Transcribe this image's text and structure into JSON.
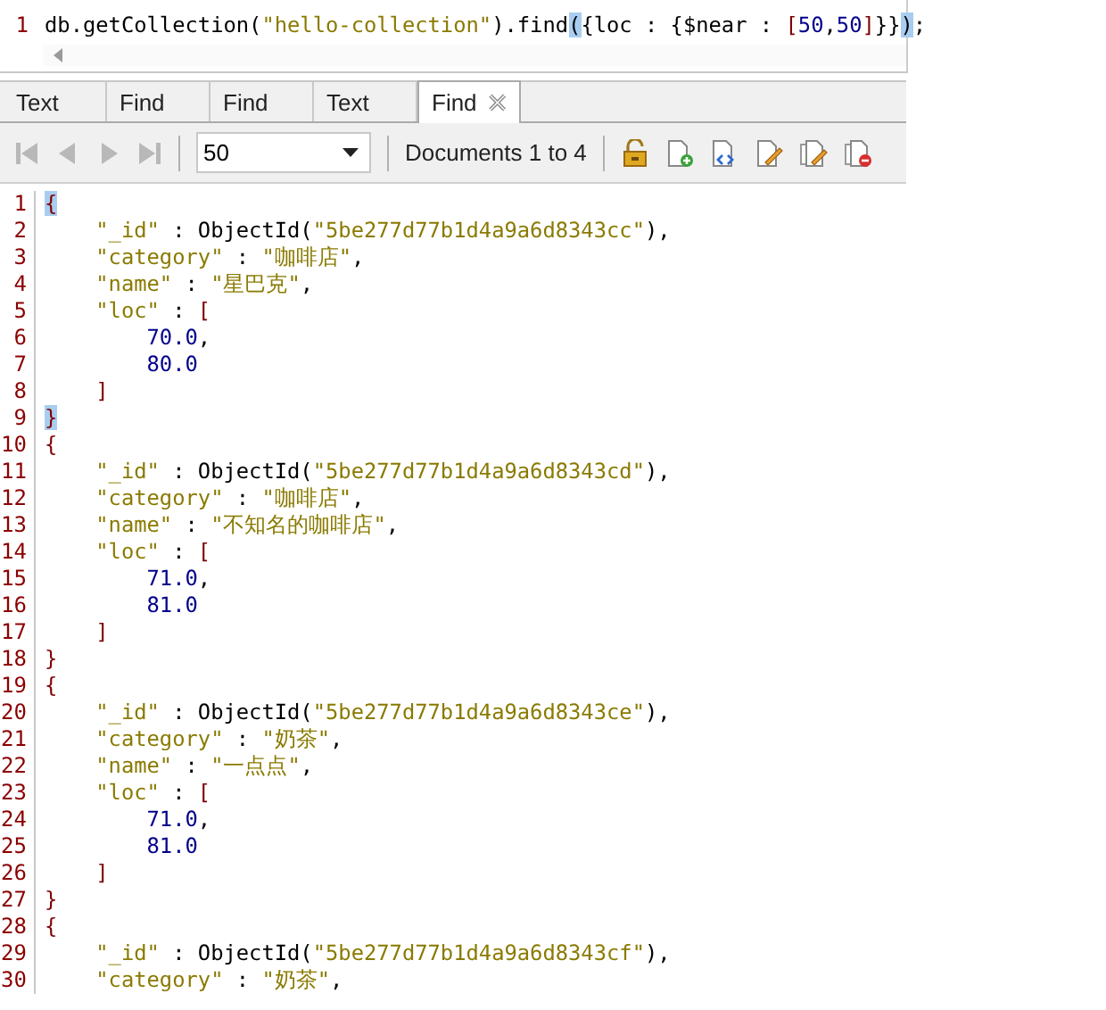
{
  "query": {
    "line_number": "1",
    "parts": [
      {
        "kind": "plain",
        "text": "db.getCollection("
      },
      {
        "kind": "string",
        "text": "\"hello-collection\""
      },
      {
        "kind": "plain",
        "text": ").find"
      },
      {
        "kind": "plain",
        "text": "(",
        "highlighted": true
      },
      {
        "kind": "plain",
        "text": "{loc : {$near : "
      },
      {
        "kind": "bracket",
        "text": "["
      },
      {
        "kind": "number",
        "text": "50"
      },
      {
        "kind": "plain",
        "text": ","
      },
      {
        "kind": "number",
        "text": "50"
      },
      {
        "kind": "bracket",
        "text": "]"
      },
      {
        "kind": "plain",
        "text": "}}"
      },
      {
        "kind": "plain",
        "text": ")",
        "highlighted": true
      },
      {
        "kind": "plain",
        "text": ";"
      }
    ]
  },
  "tabs": [
    {
      "label": "Text",
      "selected": false,
      "closable": false
    },
    {
      "label": "Find",
      "selected": false,
      "closable": false
    },
    {
      "label": "Find",
      "selected": false,
      "closable": false
    },
    {
      "label": "Text",
      "selected": false,
      "closable": false
    },
    {
      "label": "Find",
      "selected": true,
      "closable": true
    }
  ],
  "toolbar": {
    "page_size": "50",
    "documents": "Documents 1 to 4"
  },
  "lines": [
    {
      "no": "1",
      "parts": [
        {
          "kind": "bracket",
          "text": "{",
          "highlighted": true
        }
      ]
    },
    {
      "no": "2",
      "parts": [
        {
          "kind": "string",
          "text": "    \"_id\""
        },
        {
          "kind": "plain",
          "text": " : ObjectId("
        },
        {
          "kind": "string",
          "text": "\"5be277d77b1d4a9a6d8343cc\""
        },
        {
          "kind": "plain",
          "text": "),"
        }
      ]
    },
    {
      "no": "3",
      "parts": [
        {
          "kind": "string",
          "text": "    \"category\""
        },
        {
          "kind": "plain",
          "text": " : "
        },
        {
          "kind": "string",
          "text": "\"咖啡店\""
        },
        {
          "kind": "plain",
          "text": ","
        }
      ]
    },
    {
      "no": "4",
      "parts": [
        {
          "kind": "string",
          "text": "    \"name\""
        },
        {
          "kind": "plain",
          "text": " : "
        },
        {
          "kind": "string",
          "text": "\"星巴克\""
        },
        {
          "kind": "plain",
          "text": ","
        }
      ]
    },
    {
      "no": "5",
      "parts": [
        {
          "kind": "string",
          "text": "    \"loc\""
        },
        {
          "kind": "plain",
          "text": " : "
        },
        {
          "kind": "bracket",
          "text": "["
        }
      ]
    },
    {
      "no": "6",
      "parts": [
        {
          "kind": "number",
          "text": "        70.0"
        },
        {
          "kind": "plain",
          "text": ","
        }
      ]
    },
    {
      "no": "7",
      "parts": [
        {
          "kind": "number",
          "text": "        80.0"
        }
      ]
    },
    {
      "no": "8",
      "parts": [
        {
          "kind": "bracket",
          "text": "    ]"
        }
      ]
    },
    {
      "no": "9",
      "parts": [
        {
          "kind": "bracket",
          "text": "}",
          "highlighted": true
        }
      ]
    },
    {
      "no": "10",
      "parts": [
        {
          "kind": "bracket",
          "text": "{"
        }
      ]
    },
    {
      "no": "11",
      "parts": [
        {
          "kind": "string",
          "text": "    \"_id\""
        },
        {
          "kind": "plain",
          "text": " : ObjectId("
        },
        {
          "kind": "string",
          "text": "\"5be277d77b1d4a9a6d8343cd\""
        },
        {
          "kind": "plain",
          "text": "),"
        }
      ]
    },
    {
      "no": "12",
      "parts": [
        {
          "kind": "string",
          "text": "    \"category\""
        },
        {
          "kind": "plain",
          "text": " : "
        },
        {
          "kind": "string",
          "text": "\"咖啡店\""
        },
        {
          "kind": "plain",
          "text": ","
        }
      ]
    },
    {
      "no": "13",
      "parts": [
        {
          "kind": "string",
          "text": "    \"name\""
        },
        {
          "kind": "plain",
          "text": " : "
        },
        {
          "kind": "string",
          "text": "\"不知名的咖啡店\""
        },
        {
          "kind": "plain",
          "text": ","
        }
      ]
    },
    {
      "no": "14",
      "parts": [
        {
          "kind": "string",
          "text": "    \"loc\""
        },
        {
          "kind": "plain",
          "text": " : "
        },
        {
          "kind": "bracket",
          "text": "["
        }
      ]
    },
    {
      "no": "15",
      "parts": [
        {
          "kind": "number",
          "text": "        71.0"
        },
        {
          "kind": "plain",
          "text": ","
        }
      ]
    },
    {
      "no": "16",
      "parts": [
        {
          "kind": "number",
          "text": "        81.0"
        }
      ]
    },
    {
      "no": "17",
      "parts": [
        {
          "kind": "bracket",
          "text": "    ]"
        }
      ]
    },
    {
      "no": "18",
      "parts": [
        {
          "kind": "bracket",
          "text": "}"
        }
      ]
    },
    {
      "no": "19",
      "parts": [
        {
          "kind": "bracket",
          "text": "{"
        }
      ]
    },
    {
      "no": "20",
      "parts": [
        {
          "kind": "string",
          "text": "    \"_id\""
        },
        {
          "kind": "plain",
          "text": " : ObjectId("
        },
        {
          "kind": "string",
          "text": "\"5be277d77b1d4a9a6d8343ce\""
        },
        {
          "kind": "plain",
          "text": "),"
        }
      ]
    },
    {
      "no": "21",
      "parts": [
        {
          "kind": "string",
          "text": "    \"category\""
        },
        {
          "kind": "plain",
          "text": " : "
        },
        {
          "kind": "string",
          "text": "\"奶茶\""
        },
        {
          "kind": "plain",
          "text": ","
        }
      ]
    },
    {
      "no": "22",
      "parts": [
        {
          "kind": "string",
          "text": "    \"name\""
        },
        {
          "kind": "plain",
          "text": " : "
        },
        {
          "kind": "string",
          "text": "\"一点点\""
        },
        {
          "kind": "plain",
          "text": ","
        }
      ]
    },
    {
      "no": "23",
      "parts": [
        {
          "kind": "string",
          "text": "    \"loc\""
        },
        {
          "kind": "plain",
          "text": " : "
        },
        {
          "kind": "bracket",
          "text": "["
        }
      ]
    },
    {
      "no": "24",
      "parts": [
        {
          "kind": "number",
          "text": "        71.0"
        },
        {
          "kind": "plain",
          "text": ","
        }
      ]
    },
    {
      "no": "25",
      "parts": [
        {
          "kind": "number",
          "text": "        81.0"
        }
      ]
    },
    {
      "no": "26",
      "parts": [
        {
          "kind": "bracket",
          "text": "    ]"
        }
      ]
    },
    {
      "no": "27",
      "parts": [
        {
          "kind": "bracket",
          "text": "}"
        }
      ]
    },
    {
      "no": "28",
      "parts": [
        {
          "kind": "bracket",
          "text": "{"
        }
      ]
    },
    {
      "no": "29",
      "parts": [
        {
          "kind": "string",
          "text": "    \"_id\""
        },
        {
          "kind": "plain",
          "text": " : ObjectId("
        },
        {
          "kind": "string",
          "text": "\"5be277d77b1d4a9a6d8343cf\""
        },
        {
          "kind": "plain",
          "text": "),"
        }
      ]
    },
    {
      "no": "30",
      "parts": [
        {
          "kind": "string",
          "text": "    \"category\""
        },
        {
          "kind": "plain",
          "text": " : "
        },
        {
          "kind": "string",
          "text": "\"奶茶\""
        },
        {
          "kind": "plain",
          "text": ","
        }
      ]
    }
  ]
}
